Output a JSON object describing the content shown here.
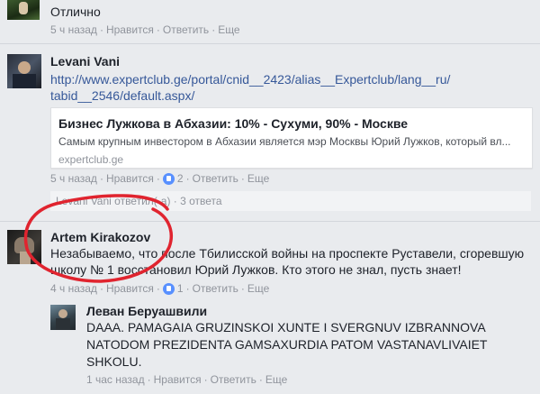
{
  "comment1": {
    "text": "Отлично",
    "time": "5 ч назад",
    "like": "Нравится",
    "reply": "Ответить",
    "more": "Еще"
  },
  "comment2": {
    "author": "Levani Vani",
    "link_line1": "http://www.expertclub.ge/portal/cnid__2423/alias__Expertclub/lang__ru/",
    "link_line2": "tabid__2546/default.aspx/",
    "card": {
      "title": "Бизнес Лужкова в Абхазии: 10% - Сухуми, 90% - Москве",
      "description": "Самым крупным инвестором в Абхазии является мэр Москвы Юрий Лужков, который вл...",
      "domain": "expertclub.ge"
    },
    "time": "5 ч назад",
    "like": "Нравится",
    "likes_count": "2",
    "reply": "Ответить",
    "more": "Еще",
    "replies_summary": "Levani Vani ответил(-а) · 3 ответа"
  },
  "comment3": {
    "author": "Artem Kirakozov",
    "text_line1": "Незабываемо, что после Тбилисской войны на проспекте Руставели, сгоревшую",
    "text_line2": "школу № 1 восстановил Юрий Лужков. Кто этого не знал, пусть знает!",
    "time": "4 ч назад",
    "like": "Нравится",
    "likes_count": "1",
    "reply": "Ответить",
    "more": "Еще"
  },
  "reply1": {
    "author": "Леван Беруашвили",
    "text_line1": "DAAA. PAMAGAIA GRUZINSKOI XUNTE I SVERGNUV IZBRANNOVA",
    "text_line2": "NATODOM PREZIDENTA GAMSAXURDIA PATOM VASTANAVLIVAIET",
    "text_line3": "SHKOLU.",
    "time": "1 час назад",
    "like": "Нравится",
    "reply": "Ответить",
    "more": "Еще"
  },
  "colors": {
    "background": "#e9ebee",
    "link": "#365899",
    "meta": "#90949c",
    "annotation_circle": "#e0242f"
  }
}
